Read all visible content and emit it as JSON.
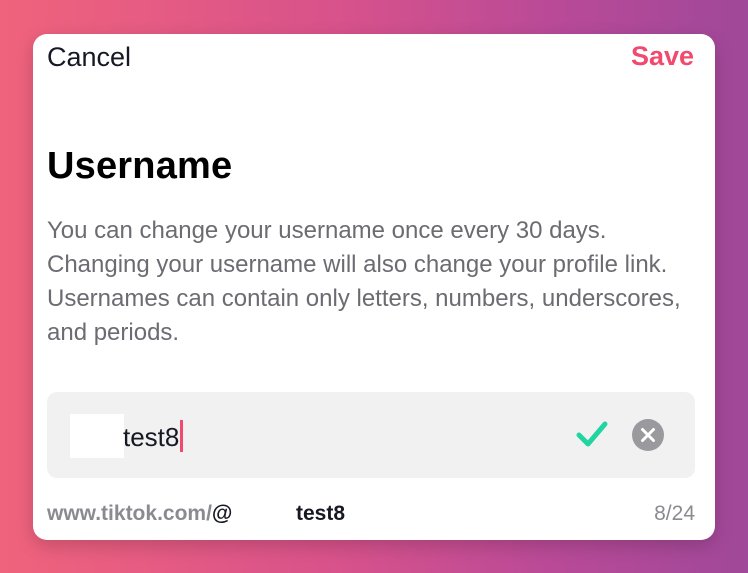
{
  "header": {
    "cancel_label": "Cancel",
    "save_label": "Save"
  },
  "main": {
    "title": "Username",
    "description": "You can change your username once every 30 days. Changing your username will also change your profile link. Usernames can contain only letters, numbers, underscores, and periods."
  },
  "username_field": {
    "value": "test8",
    "valid_icon": "check-icon",
    "clear_icon": "clear-icon"
  },
  "footer": {
    "link_prefix": "www.tiktok.com/",
    "link_at": "@",
    "link_username": "test8",
    "char_count": "8/24"
  },
  "colors": {
    "accent": "#f2496e",
    "valid": "#20d5a0",
    "clear": "#9a9a9e",
    "input_bg": "#f1f1f2"
  }
}
